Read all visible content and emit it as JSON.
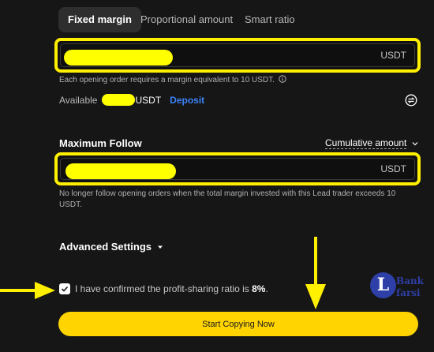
{
  "tabs": [
    {
      "label": "Fixed margin",
      "active": true
    },
    {
      "label": "Proportional amount",
      "active": false
    },
    {
      "label": "Smart ratio",
      "active": false
    }
  ],
  "margin_input": {
    "unit": "USDT",
    "value": ""
  },
  "margin_hint": "Each opening order requires a margin equivalent to 10 USDT.",
  "available": {
    "label": "Available",
    "unit": "USDT",
    "deposit_label": "Deposit"
  },
  "max_follow": {
    "title": "Maximum Follow",
    "dropdown_label": "Cumulative amount",
    "unit": "USDT",
    "value": "",
    "hint": "No longer follow opening orders when the total margin invested with this Lead trader exceeds 10 USDT."
  },
  "advanced": {
    "title": "Advanced Settings"
  },
  "confirm": {
    "text": "I have confirmed the profit-sharing ratio is",
    "ratio": "8%",
    "suffix": ".",
    "checked": true
  },
  "start_button": "Start Copying Now",
  "watermark": {
    "letter": "L",
    "line1": "Bank",
    "line2": "farsi"
  },
  "colors": {
    "accent_yellow": "#ffd400",
    "highlight_yellow": "#ffef00",
    "link_blue": "#3b82f6",
    "background": "#161616"
  }
}
